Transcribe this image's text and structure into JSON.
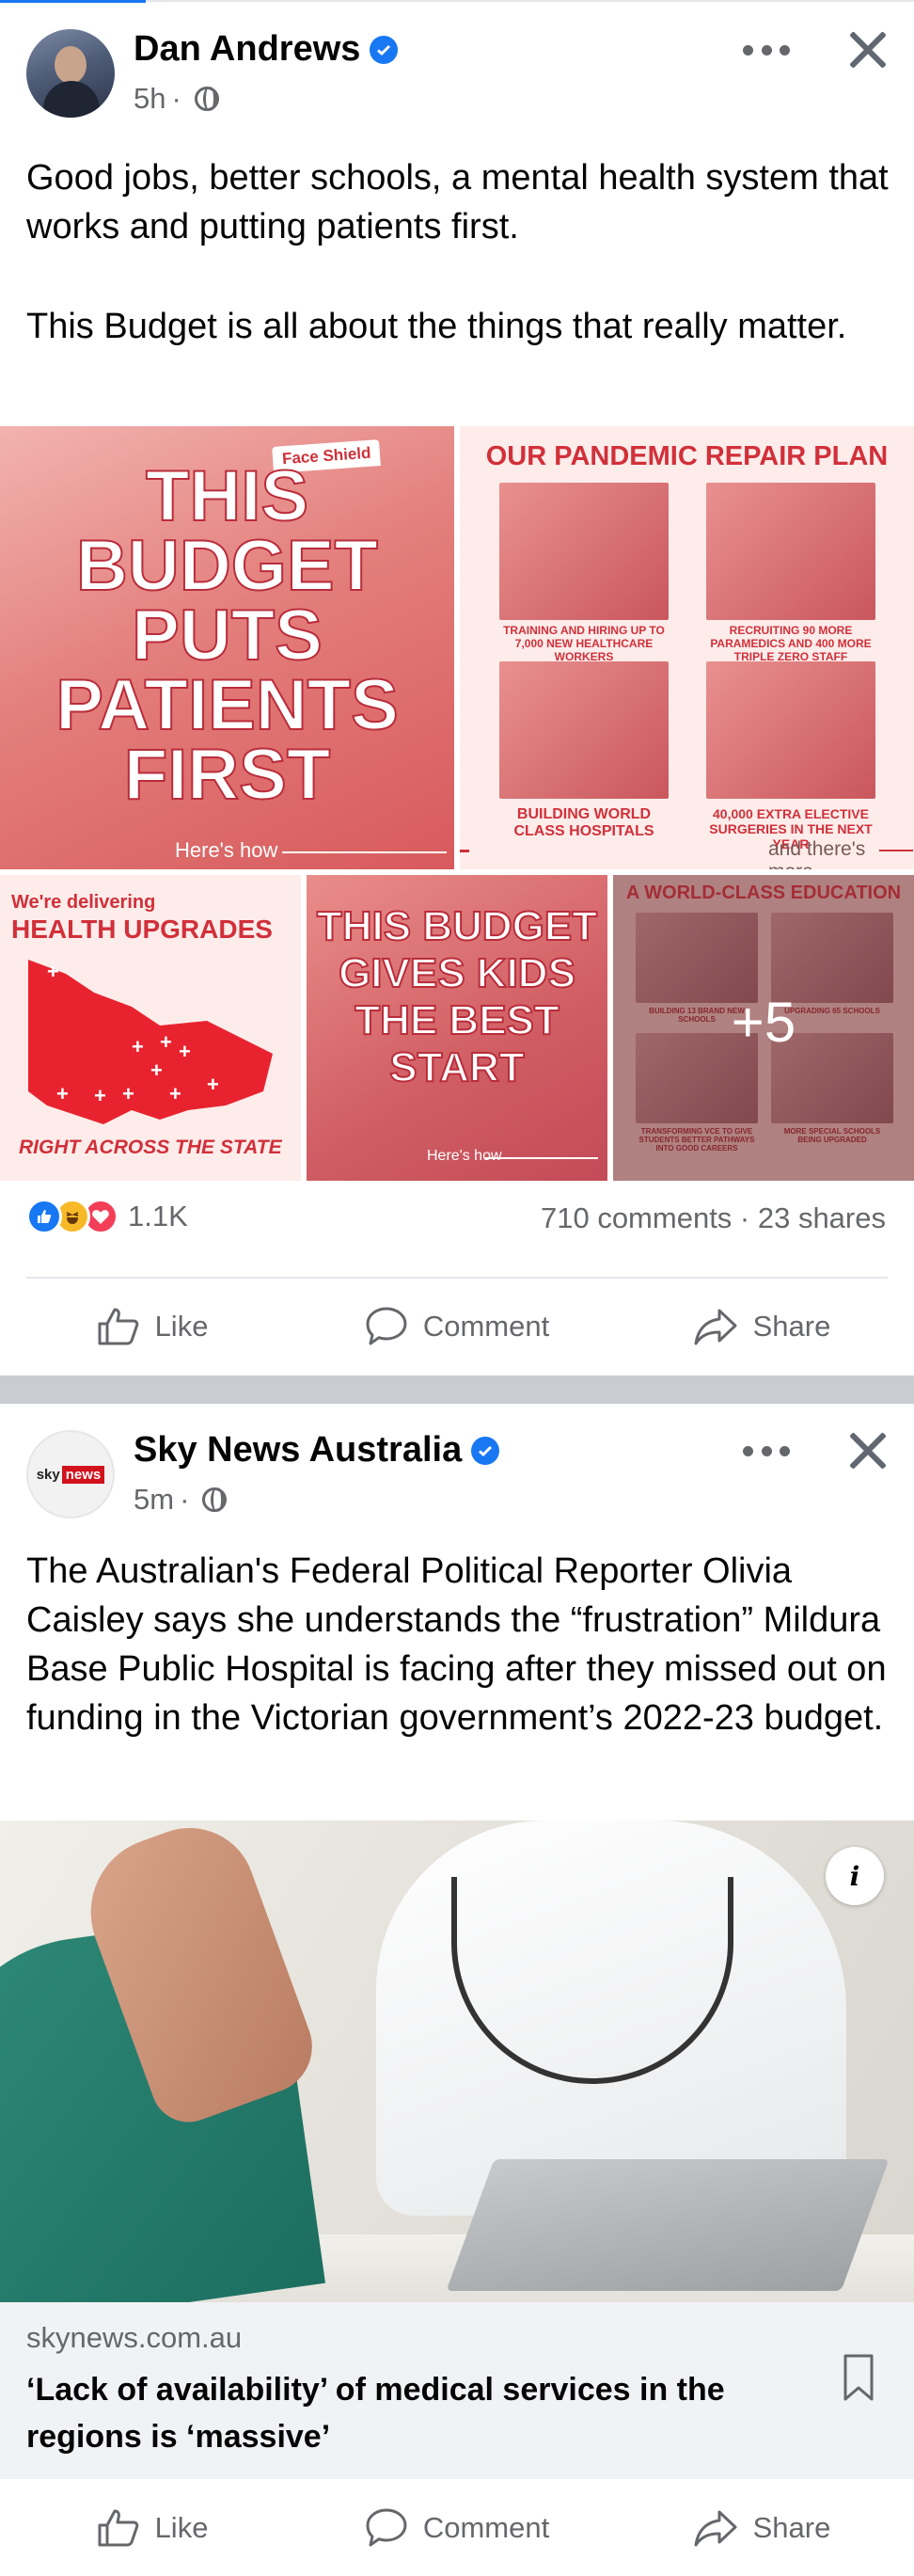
{
  "post1": {
    "author": "Dan Andrews",
    "time": "5h",
    "dot": "·",
    "text_line1": "Good jobs, better schools, a mental health system that works and putting patients first.",
    "text_line2": "This Budget is all about the things that really matter.",
    "tiles": {
      "a": {
        "badge": "Face Shield",
        "headline": "THIS BUDGET PUTS PATIENTS FIRST",
        "footer": "Here's how"
      },
      "b": {
        "title": "OUR PANDEMIC REPAIR PLAN",
        "cap1": "TRAINING AND HIRING UP TO 7,000 NEW HEALTHCARE WORKERS",
        "cap2": "RECRUITING 90 MORE PARAMEDICS AND 400 MORE TRIPLE ZERO STAFF",
        "cap3": "BUILDING WORLD CLASS HOSPITALS",
        "cap4": "40,000 EXTRA ELECTIVE SURGERIES IN THE NEXT YEAR",
        "footer": "and there's more"
      },
      "c": {
        "line1": "We're delivering",
        "line2": "HEALTH UPGRADES",
        "bottom": "RIGHT ACROSS THE STATE"
      },
      "d": {
        "headline": "THIS BUDGET GIVES KIDS THE BEST START",
        "footer": "Here's how"
      },
      "e": {
        "title": "A WORLD-CLASS EDUCATION",
        "cap1": "BUILDING 13 BRAND NEW SCHOOLS",
        "cap2": "UPGRADING 65 SCHOOLS",
        "cap3": "TRANSFORMING VCE TO GIVE STUDENTS BETTER PATHWAYS INTO GOOD CAREERS",
        "cap4": "MORE SPECIAL SCHOOLS BEING UPGRADED",
        "more_count": "+5"
      }
    },
    "reaction_count": "1.1K",
    "engagement": "710 comments · 23 shares",
    "actions": {
      "like": "Like",
      "comment": "Comment",
      "share": "Share"
    }
  },
  "post2": {
    "author": "Sky News Australia",
    "logo_sky": "sky",
    "logo_news": "news",
    "time": "5m",
    "dot": "·",
    "text": "The Australian's Federal Political Reporter Olivia Caisley says she understands the “frustration” Mildura Base Public Hospital is facing after they missed out on funding in the Victorian government’s 2022-23 budget.",
    "link": {
      "domain": "skynews.com.au",
      "headline": "‘Lack of availability’ of medical services in the regions is ‘massive’",
      "info": "i"
    },
    "actions": {
      "like": "Like",
      "comment": "Comment",
      "share": "Share"
    }
  },
  "colors": {
    "facebook_blue": "#1877f2",
    "muted_text": "#65676b",
    "budget_red": "#d1303a",
    "sky_red": "#d1121d"
  },
  "icons": [
    "more-options-icon",
    "close-icon",
    "verified-badge-icon",
    "globe-icon",
    "like-reaction-icon",
    "haha-reaction-icon",
    "love-reaction-icon",
    "like-icon",
    "comment-icon",
    "share-icon",
    "info-icon",
    "bookmark-icon"
  ]
}
